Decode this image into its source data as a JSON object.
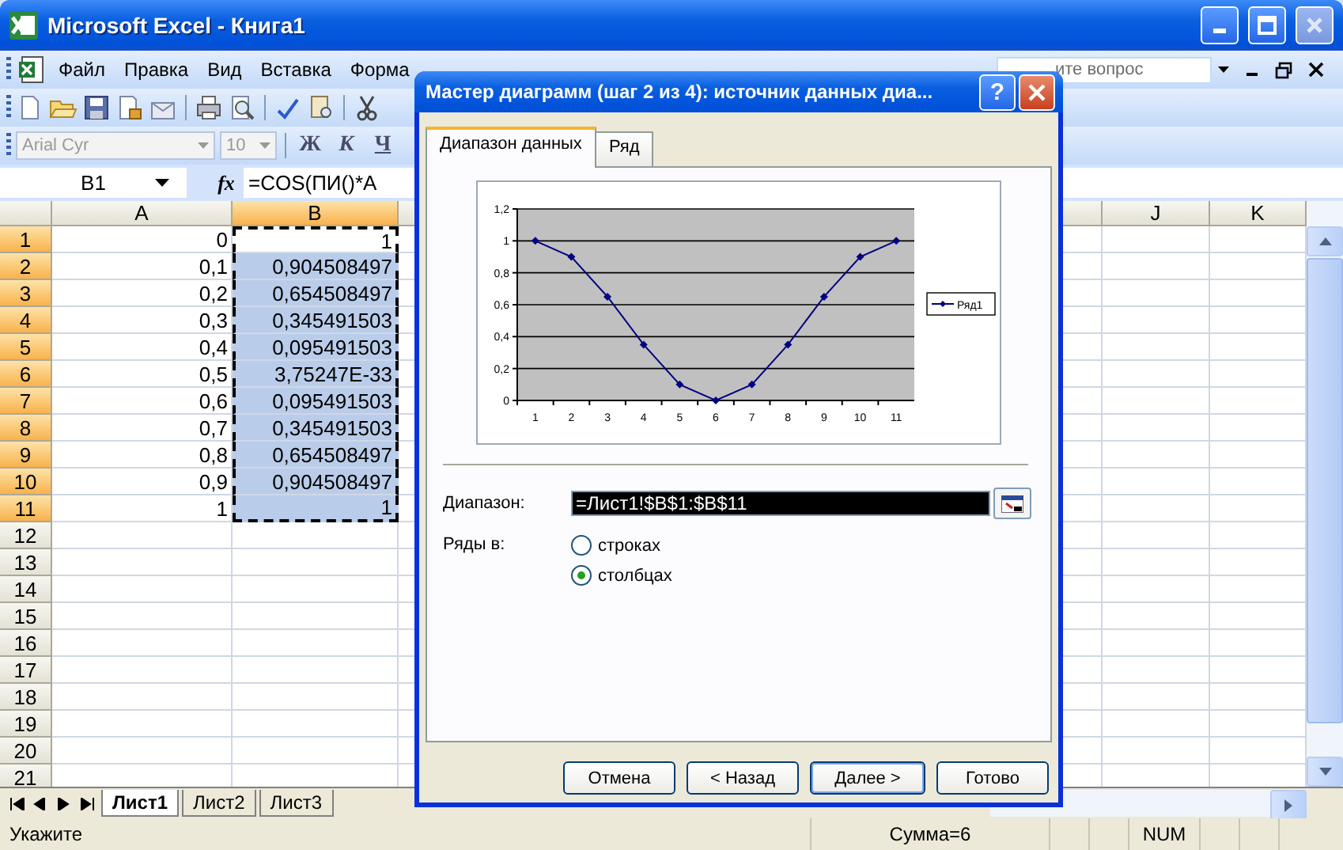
{
  "window": {
    "title": "Microsoft Excel - Книга1"
  },
  "menu": {
    "items": [
      "Файл",
      "Правка",
      "Вид",
      "Вставка",
      "Форма"
    ],
    "help_field": {
      "placeholder": "ите вопрос"
    }
  },
  "format_toolbar": {
    "font": "Arial Cyr",
    "size": "10",
    "buttons": [
      "Ж",
      "К",
      "Ч"
    ]
  },
  "formula_bar": {
    "name_box": "B1",
    "fx": "fx",
    "formula": "=COS(ПИ()*A"
  },
  "sheet": {
    "columns": [
      {
        "label": "A",
        "selected": false
      },
      {
        "label": "B",
        "selected": true
      },
      {
        "label": "J",
        "selected": false
      },
      {
        "label": "K",
        "selected": false
      }
    ],
    "rows": [
      {
        "label": "1",
        "selected": true,
        "cells": [
          {
            "text": "0",
            "highlighted": false,
            "in_range": false
          },
          {
            "text": "1",
            "highlighted": false,
            "in_range": true
          }
        ]
      },
      {
        "label": "2",
        "selected": true,
        "cells": [
          {
            "text": "0,1",
            "highlighted": false,
            "in_range": false
          },
          {
            "text": "0,904508497",
            "highlighted": true,
            "in_range": true
          }
        ]
      },
      {
        "label": "3",
        "selected": true,
        "cells": [
          {
            "text": "0,2",
            "highlighted": false,
            "in_range": false
          },
          {
            "text": "0,654508497",
            "highlighted": true,
            "in_range": true
          }
        ]
      },
      {
        "label": "4",
        "selected": true,
        "cells": [
          {
            "text": "0,3",
            "highlighted": false,
            "in_range": false
          },
          {
            "text": "0,345491503",
            "highlighted": true,
            "in_range": true
          }
        ]
      },
      {
        "label": "5",
        "selected": true,
        "cells": [
          {
            "text": "0,4",
            "highlighted": false,
            "in_range": false
          },
          {
            "text": "0,095491503",
            "highlighted": true,
            "in_range": true
          }
        ]
      },
      {
        "label": "6",
        "selected": true,
        "cells": [
          {
            "text": "0,5",
            "highlighted": false,
            "in_range": false
          },
          {
            "text": "3,75247E-33",
            "highlighted": true,
            "in_range": true
          }
        ]
      },
      {
        "label": "7",
        "selected": true,
        "cells": [
          {
            "text": "0,6",
            "highlighted": false,
            "in_range": false
          },
          {
            "text": "0,095491503",
            "highlighted": true,
            "in_range": true
          }
        ]
      },
      {
        "label": "8",
        "selected": true,
        "cells": [
          {
            "text": "0,7",
            "highlighted": false,
            "in_range": false
          },
          {
            "text": "0,345491503",
            "highlighted": true,
            "in_range": true
          }
        ]
      },
      {
        "label": "9",
        "selected": true,
        "cells": [
          {
            "text": "0,8",
            "highlighted": false,
            "in_range": false
          },
          {
            "text": "0,654508497",
            "highlighted": true,
            "in_range": true
          }
        ]
      },
      {
        "label": "10",
        "selected": true,
        "cells": [
          {
            "text": "0,9",
            "highlighted": false,
            "in_range": false
          },
          {
            "text": "0,904508497",
            "highlighted": true,
            "in_range": true
          }
        ]
      },
      {
        "label": "11",
        "selected": true,
        "cells": [
          {
            "text": "1",
            "highlighted": false,
            "in_range": false
          },
          {
            "text": "1",
            "highlighted": true,
            "in_range": true
          }
        ]
      },
      {
        "label": "12",
        "selected": false
      },
      {
        "label": "13",
        "selected": false
      },
      {
        "label": "14",
        "selected": false
      },
      {
        "label": "15",
        "selected": false
      },
      {
        "label": "16",
        "selected": false
      },
      {
        "label": "17",
        "selected": false
      },
      {
        "label": "18",
        "selected": false
      },
      {
        "label": "19",
        "selected": false
      },
      {
        "label": "20",
        "selected": false
      },
      {
        "label": "21",
        "selected": false
      }
    ]
  },
  "sheet_tabs": [
    {
      "label": "Лист1",
      "selected": true
    },
    {
      "label": "Лист2",
      "selected": false
    },
    {
      "label": "Лист3",
      "selected": false
    }
  ],
  "status_bar": {
    "message": "Укажите",
    "sum": "Сумма=6",
    "num": "NUM"
  },
  "dialog": {
    "title": "Мастер диаграмм (шаг 2 из 4): источник данных диа...",
    "help_button": "?",
    "tabs": [
      {
        "label": "Диапазон данных",
        "selected": true
      },
      {
        "label": "Ряд",
        "selected": false
      }
    ],
    "chart_data": {
      "type": "line",
      "categories": [
        "1",
        "2",
        "3",
        "4",
        "5",
        "6",
        "7",
        "8",
        "9",
        "10",
        "11"
      ],
      "series": [
        {
          "name": "Ряд1",
          "color": "#000080",
          "marker": "diamond",
          "values": [
            1,
            0.9,
            0.65,
            0.35,
            0.1,
            0,
            0.1,
            0.35,
            0.65,
            0.9,
            1
          ]
        }
      ],
      "grid": true,
      "ylim": [
        0,
        1.2
      ],
      "yticks": [
        {
          "value": 0,
          "label": "0"
        },
        {
          "value": 0.2,
          "label": "0,2"
        },
        {
          "value": 0.4,
          "label": "0,4"
        },
        {
          "value": 0.6,
          "label": "0,6"
        },
        {
          "value": 0.8,
          "label": "0,8"
        },
        {
          "value": 1,
          "label": "1"
        },
        {
          "value": 1.2,
          "label": "1,2"
        }
      ]
    },
    "range_label": "Диапазон:",
    "range_value": "=Лист1!$B$1:$B$11",
    "series_in_label": "Ряды в:",
    "series_in": [
      {
        "label": "строках",
        "selected": false
      },
      {
        "label": "столбцах",
        "selected": true
      }
    ],
    "buttons": [
      {
        "label": "Отмена",
        "default": false
      },
      {
        "label": "< Назад",
        "default": false
      },
      {
        "label": "Далее >",
        "default": true
      },
      {
        "label": "Готово",
        "default": false
      }
    ]
  }
}
